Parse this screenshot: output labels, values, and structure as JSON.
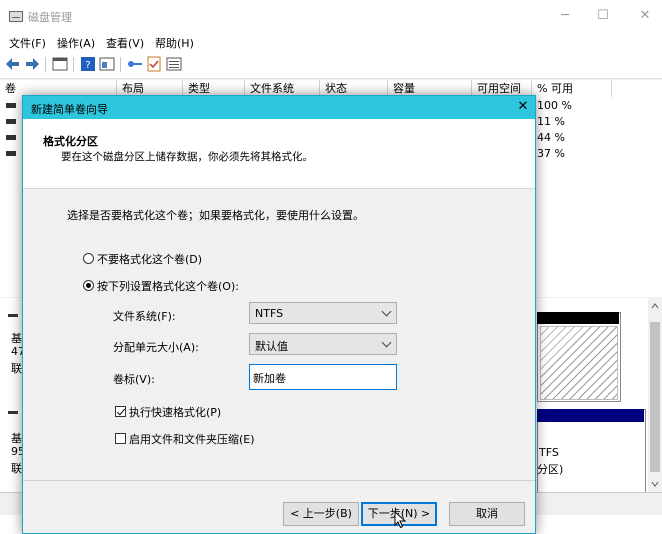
{
  "window": {
    "title": "磁盘管理",
    "controls": [
      "─",
      "☐",
      "✕"
    ]
  },
  "menu": [
    "文件(F)",
    "操作(A)",
    "查看(V)",
    "帮助(H)"
  ],
  "volume_list": {
    "columns": [
      "卷",
      "布局",
      "类型",
      "文件系统",
      "状态",
      "容量",
      "可用空间",
      "% 可用"
    ],
    "percent_free": [
      "100 %",
      "11 %",
      "44 %",
      "37 %"
    ]
  },
  "disk_panel": {
    "disk0_label_fragments": [
      "基",
      "47",
      "联"
    ],
    "disk1_label_fragments": [
      "基",
      "95",
      "联"
    ],
    "disk1_partition_fragments": [
      "TFS",
      "分区)"
    ]
  },
  "wizard": {
    "title": "新建简单卷向导",
    "close": "✕",
    "header_title": "格式化分区",
    "header_subtitle": "要在这个磁盘分区上储存数据，你必须先将其格式化。",
    "question": "选择是否要格式化这个卷；如果要格式化，要使用什么设置。",
    "option_no_format": "不要格式化这个卷(D)",
    "option_format": "按下列设置格式化这个卷(O):",
    "selected_option": "format",
    "file_system_label": "文件系统(F):",
    "file_system_value": "NTFS",
    "allocation_label": "分配单元大小(A):",
    "allocation_value": "默认值",
    "volume_label_label": "卷标(V):",
    "volume_label_value": "新加卷",
    "quick_format_label": "执行快速格式化(P)",
    "quick_format_checked": true,
    "compression_label": "启用文件和文件夹压缩(E)",
    "compression_checked": false,
    "back_button": "< 上一步(B)",
    "next_button": "下一步(N) >",
    "cancel_button": "取消"
  },
  "colors": {
    "wizard_titlebar": "#2ec6dc",
    "focus_blue": "#0078d7",
    "disk_bar_navy": "#000080"
  }
}
